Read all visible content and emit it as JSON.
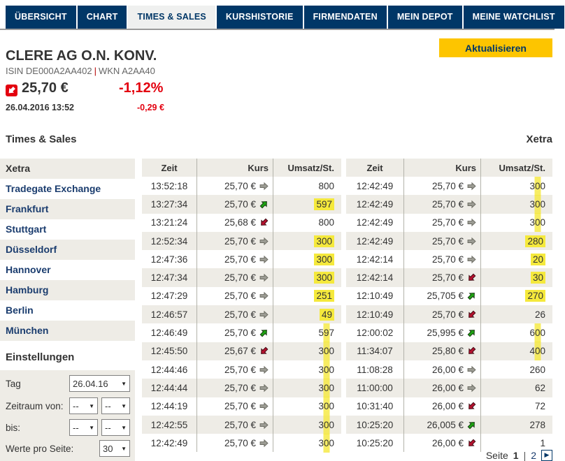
{
  "tabs": [
    {
      "label": "ÜBERSICHT",
      "name": "tab-uebersicht",
      "active": false
    },
    {
      "label": "CHART",
      "name": "tab-chart",
      "active": false
    },
    {
      "label": "TIMES & SALES",
      "name": "tab-times-and-sales",
      "active": true
    },
    {
      "label": "KURSHISTORIE",
      "name": "tab-kurshistorie",
      "active": false
    },
    {
      "label": "FIRMENDATEN",
      "name": "tab-firmendaten",
      "active": false
    },
    {
      "label": "MEIN DEPOT",
      "name": "tab-mein-depot",
      "active": false
    },
    {
      "label": "MEINE WATCHLIST",
      "name": "tab-meine-watchlist",
      "active": false
    }
  ],
  "header": {
    "title": "CLERE AG O.N. KONV.",
    "isin": "ISIN DE000A2AA402",
    "isin_sep": "|",
    "wkn": "WKN A2AA40",
    "refresh_label": "Aktualisieren",
    "price": "25,70 €",
    "change_pct": "-1,12%",
    "datetime": "26.04.2016  13:52",
    "change_abs": "-0,29 €",
    "trend": "down"
  },
  "section": {
    "title": "Times & Sales",
    "venue": "Xetra"
  },
  "sidebar": {
    "items": [
      {
        "label": "Xetra",
        "name": "sidebar-item-xetra",
        "active": true
      },
      {
        "label": "Tradegate Exchange",
        "name": "sidebar-item-tradegate-exchange",
        "active": false
      },
      {
        "label": "Frankfurt",
        "name": "sidebar-item-frankfurt",
        "active": false
      },
      {
        "label": "Stuttgart",
        "name": "sidebar-item-stuttgart",
        "active": false
      },
      {
        "label": "Düsseldorf",
        "name": "sidebar-item-duesseldorf",
        "active": false
      },
      {
        "label": "Hannover",
        "name": "sidebar-item-hannover",
        "active": false
      },
      {
        "label": "Hamburg",
        "name": "sidebar-item-hamburg",
        "active": false
      },
      {
        "label": "Berlin",
        "name": "sidebar-item-berlin",
        "active": false
      },
      {
        "label": "München",
        "name": "sidebar-item-muenchen",
        "active": false
      }
    ]
  },
  "settings": {
    "heading": "Einstellungen",
    "tag_label": "Tag",
    "tag_value": "26.04.16",
    "from_label": "Zeitraum von:",
    "from_hour": "--",
    "from_min": "--",
    "to_label": "bis:",
    "to_hour": "--",
    "to_min": "--",
    "per_page_label": "Werte pro Seite:",
    "per_page_value": "30"
  },
  "table": {
    "columns": [
      "Zeit",
      "Kurs",
      "Umsatz/St."
    ],
    "left_rows": [
      {
        "time": "13:52:18",
        "price": "25,70 €",
        "dir": "right",
        "volume": "800",
        "hl": "none"
      },
      {
        "time": "13:27:34",
        "price": "25,70 €",
        "dir": "up",
        "volume": "597",
        "hl": "full"
      },
      {
        "time": "13:21:24",
        "price": "25,68 €",
        "dir": "down",
        "volume": "800",
        "hl": "none"
      },
      {
        "time": "12:52:34",
        "price": "25,70 €",
        "dir": "right",
        "volume": "300",
        "hl": "full"
      },
      {
        "time": "12:47:36",
        "price": "25,70 €",
        "dir": "right",
        "volume": "300",
        "hl": "full"
      },
      {
        "time": "12:47:34",
        "price": "25,70 €",
        "dir": "right",
        "volume": "300",
        "hl": "full"
      },
      {
        "time": "12:47:29",
        "price": "25,70 €",
        "dir": "right",
        "volume": "251",
        "hl": "full"
      },
      {
        "time": "12:46:57",
        "price": "25,70 €",
        "dir": "right",
        "volume": "49",
        "hl": "full"
      },
      {
        "time": "12:46:49",
        "price": "25,70 €",
        "dir": "up",
        "volume": "597",
        "hl": "stripe"
      },
      {
        "time": "12:45:50",
        "price": "25,67 €",
        "dir": "down",
        "volume": "300",
        "hl": "stripe"
      },
      {
        "time": "12:44:46",
        "price": "25,70 €",
        "dir": "right",
        "volume": "300",
        "hl": "stripe"
      },
      {
        "time": "12:44:44",
        "price": "25,70 €",
        "dir": "right",
        "volume": "300",
        "hl": "stripe"
      },
      {
        "time": "12:44:19",
        "price": "25,70 €",
        "dir": "right",
        "volume": "300",
        "hl": "stripe"
      },
      {
        "time": "12:42:55",
        "price": "25,70 €",
        "dir": "right",
        "volume": "300",
        "hl": "stripe"
      },
      {
        "time": "12:42:49",
        "price": "25,70 €",
        "dir": "right",
        "volume": "300",
        "hl": "stripe"
      }
    ],
    "right_rows": [
      {
        "time": "12:42:49",
        "price": "25,70 €",
        "dir": "right",
        "volume": "300",
        "hl": "stripe"
      },
      {
        "time": "12:42:49",
        "price": "25,70 €",
        "dir": "right",
        "volume": "300",
        "hl": "stripe"
      },
      {
        "time": "12:42:49",
        "price": "25,70 €",
        "dir": "right",
        "volume": "300",
        "hl": "stripe"
      },
      {
        "time": "12:42:49",
        "price": "25,70 €",
        "dir": "right",
        "volume": "280",
        "hl": "full"
      },
      {
        "time": "12:42:14",
        "price": "25,70 €",
        "dir": "right",
        "volume": "20",
        "hl": "full"
      },
      {
        "time": "12:42:14",
        "price": "25,70 €",
        "dir": "down",
        "volume": "30",
        "hl": "full"
      },
      {
        "time": "12:10:49",
        "price": "25,705 €",
        "dir": "up",
        "volume": "270",
        "hl": "full"
      },
      {
        "time": "12:10:49",
        "price": "25,70 €",
        "dir": "down",
        "volume": "26",
        "hl": "none"
      },
      {
        "time": "12:00:02",
        "price": "25,995 €",
        "dir": "up",
        "volume": "600",
        "hl": "stripe"
      },
      {
        "time": "11:34:07",
        "price": "25,80 €",
        "dir": "down",
        "volume": "400",
        "hl": "stripe"
      },
      {
        "time": "11:08:28",
        "price": "26,00 €",
        "dir": "right",
        "volume": "260",
        "hl": "none"
      },
      {
        "time": "11:00:00",
        "price": "26,00 €",
        "dir": "right",
        "volume": "62",
        "hl": "none"
      },
      {
        "time": "10:31:40",
        "price": "26,00 €",
        "dir": "down",
        "volume": "72",
        "hl": "none"
      },
      {
        "time": "10:25:20",
        "price": "26,005 €",
        "dir": "up",
        "volume": "278",
        "hl": "none"
      },
      {
        "time": "10:25:20",
        "price": "26,00 €",
        "dir": "down",
        "volume": "1",
        "hl": "none"
      }
    ]
  },
  "pagination": {
    "label": "Seite",
    "current": "1",
    "sep": "|",
    "next": "2"
  },
  "colors": {
    "navy": "#003767",
    "gold": "#fdc500",
    "negative_red": "#e3000f",
    "row_beige": "#eeece6",
    "highlight_yellow": "#f5e93c",
    "arrow_up_green": "#1ea312",
    "arrow_down_red": "#b5122f",
    "arrow_neutral_gray": "#9c9c94"
  }
}
